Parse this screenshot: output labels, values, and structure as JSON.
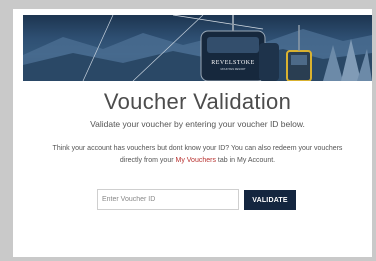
{
  "hero": {
    "brand_name": "REVELSTOKE",
    "brand_tagline": "MOUNTAIN RESORT",
    "icon": "gondola-cabin"
  },
  "main": {
    "title": "Voucher Validation",
    "subtitle": "Validate your voucher by entering your voucher ID below.",
    "info_text_before": "Think your account has vouchers but dont know your ID? You can also redeem your vouchers directly from your ",
    "info_link": "My Vouchers",
    "info_text_after": " tab in My Account."
  },
  "form": {
    "voucher_placeholder": "Enter Voucher ID",
    "voucher_value": "",
    "validate_label": "VALIDATE"
  },
  "colors": {
    "page_background": "#c9c9c9",
    "button_background": "#14263f",
    "link": "#b8312f",
    "title_text": "#4c4c4c"
  }
}
